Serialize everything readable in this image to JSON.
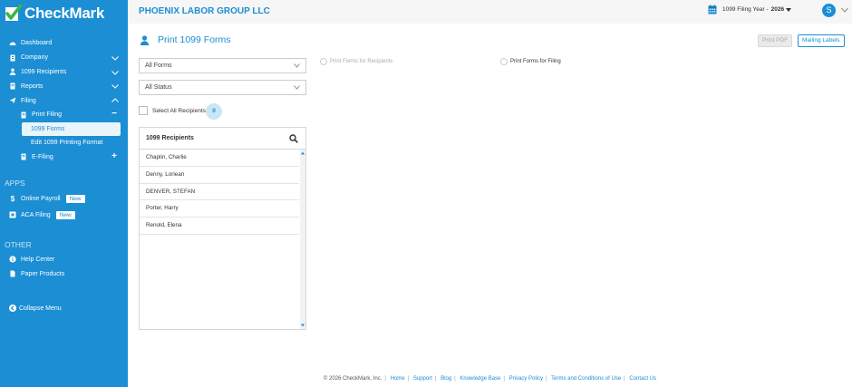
{
  "app": {
    "logo_text": "CheckMark"
  },
  "header": {
    "company": "PHOENIX LABOR GROUP LLC",
    "filing_year_label": "1099 Filing Year -",
    "filing_year": "2026",
    "user_initial": "S"
  },
  "sidebar": {
    "items": [
      {
        "label": "Dashboard"
      },
      {
        "label": "Company"
      },
      {
        "label": "1099 Recipients"
      },
      {
        "label": "Reports"
      },
      {
        "label": "Filing"
      },
      {
        "label": "Print Filing"
      },
      {
        "label": "1099 Forms"
      },
      {
        "label": "Edit 1099 Printing Format"
      },
      {
        "label": "E-Filing"
      }
    ],
    "apps_header": "APPS",
    "apps": [
      {
        "label": "Online Payroll",
        "badge": "New"
      },
      {
        "label": "ACA Filing",
        "badge": "New"
      }
    ],
    "other_header": "OTHER",
    "other": [
      {
        "label": "Help Center"
      },
      {
        "label": "Paper Products"
      }
    ],
    "collapse_label": "Collapse Menu"
  },
  "main": {
    "title": "Print 1099 Forms",
    "print_pdf": "Print PDF",
    "mailing_labels": "Mailing Labels",
    "form_select": "All Forms",
    "status_select": "All Status",
    "radio_recipients": "Print Forms for Recipients",
    "radio_filing": "Print Forms for Filing",
    "select_all_label": "Select All Recipients",
    "selected_count": "0",
    "recipients_header": "1099 Recipients",
    "recipients": [
      "Chaplin, Charlie",
      "Denny, Loriean",
      "DENVER, STEFAN",
      "Porter, Harry",
      "Renold, Elena"
    ]
  },
  "footer": {
    "copyright": "© 2026 CheckMark, Inc.",
    "links": [
      "Home",
      "Support",
      "Blog",
      "Knowledge Base",
      "Privacy Policy",
      "Terms and Conditions of Use",
      "Contact Us"
    ]
  },
  "colors": {
    "accent": "#1b8ed4",
    "sidebar_bg": "#1b8ed4",
    "active_bg": "#e9f4fb"
  }
}
